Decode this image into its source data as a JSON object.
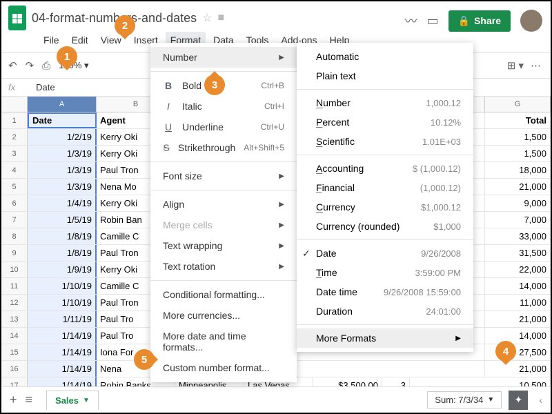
{
  "doc": {
    "title": "04-format-numbers-and-dates"
  },
  "menus": [
    "File",
    "Edit",
    "View",
    "Insert",
    "Format",
    "Data",
    "Tools",
    "Add-ons",
    "Help"
  ],
  "share": "Share",
  "zoom": "100%",
  "formula": {
    "fx": "fx",
    "value": "Date"
  },
  "columns": {
    "a": "A",
    "b": "B",
    "g": "G"
  },
  "header_row": {
    "a": "Date",
    "b": "Agent",
    "g": "Total"
  },
  "rows": [
    {
      "a": "1/2/19",
      "b": "Kerry Oki",
      "g": "1,500"
    },
    {
      "a": "1/3/19",
      "b": "Kerry Oki",
      "g": "1,500"
    },
    {
      "a": "1/3/19",
      "b": "Paul Tron",
      "g": "18,000"
    },
    {
      "a": "1/3/19",
      "b": "Nena Mo",
      "g": "21,000"
    },
    {
      "a": "1/4/19",
      "b": "Kerry Oki",
      "g": "9,000"
    },
    {
      "a": "1/5/19",
      "b": "Robin Ban",
      "g": "7,000"
    },
    {
      "a": "1/8/19",
      "b": "Camille C",
      "g": "33,000"
    },
    {
      "a": "1/8/19",
      "b": "Paul Tron",
      "g": "31,500"
    },
    {
      "a": "1/9/19",
      "b": "Kerry Oki",
      "g": "22,000"
    },
    {
      "a": "1/10/19",
      "b": "Camille C",
      "g": "14,000"
    },
    {
      "a": "1/10/19",
      "b": "Paul Tron",
      "g": "11,000"
    },
    {
      "a": "1/11/19",
      "b": "Paul Tro",
      "g": "21,000"
    },
    {
      "a": "1/14/19",
      "b": "Paul Tro",
      "g": "14,000"
    },
    {
      "a": "1/14/19",
      "b": "Iona For",
      "g": "27,500"
    },
    {
      "a": "1/14/19",
      "b": "Nena",
      "g": "21,000"
    },
    {
      "a": "1/14/19",
      "b": "Robin Banks",
      "g": "10,500"
    }
  ],
  "row17_extra": {
    "c": "Minneapolis",
    "d": "Las Vegas",
    "e": "$3,500.00",
    "f": "3"
  },
  "format_menu": {
    "number": "Number",
    "bold": "Bold",
    "bold_k": "Ctrl+B",
    "italic": "Italic",
    "italic_k": "Ctrl+I",
    "underline": "Underline",
    "underline_k": "Ctrl+U",
    "strike": "Strikethrough",
    "strike_k": "Alt+Shift+5",
    "fontsize": "Font size",
    "align": "Align",
    "merge": "Merge cells",
    "wrap": "Text wrapping",
    "rotate": "Text rotation",
    "cond": "Conditional formatting...",
    "more_curr": "More currencies...",
    "more_date": "More date and time formats...",
    "custom": "Custom number format..."
  },
  "num_menu": {
    "auto": "Automatic",
    "plain": "Plain text",
    "number": "Number",
    "number_ex": "1,000.12",
    "percent": "Percent",
    "percent_ex": "10.12%",
    "sci": "Scientific",
    "sci_ex": "1.01E+03",
    "acct": "Accounting",
    "acct_ex": "$ (1,000.12)",
    "fin": "Financial",
    "fin_ex": "(1,000.12)",
    "curr": "Currency",
    "curr_ex": "$1,000.12",
    "currr": "Currency (rounded)",
    "currr_ex": "$1,000",
    "date": "Date",
    "date_ex": "9/26/2008",
    "time": "Time",
    "time_ex": "3:59:00 PM",
    "dt": "Date time",
    "dt_ex": "9/26/2008 15:59:00",
    "dur": "Duration",
    "dur_ex": "24:01:00",
    "more": "More Formats"
  },
  "sheet_tab": "Sales",
  "sum": "Sum: 7/3/34",
  "callouts": {
    "1": "1",
    "2": "2",
    "3": "3",
    "4": "4",
    "5": "5"
  }
}
